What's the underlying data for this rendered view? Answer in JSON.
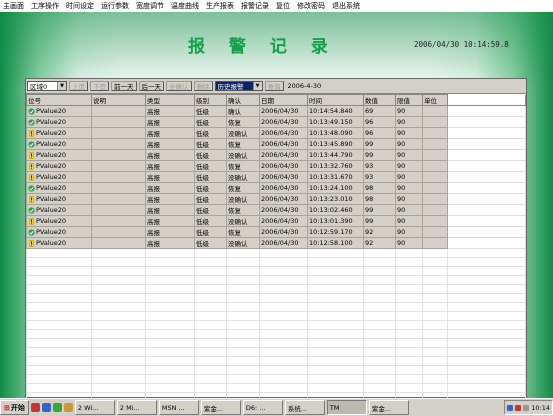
{
  "menu": [
    "主画面",
    "工序操作",
    "时间设定",
    "运行参数",
    "宽度调节",
    "温度曲线",
    "生产报表",
    "报警记录",
    "复位",
    "修改密码",
    "退出系统"
  ],
  "title": "报 警 记 录",
  "clock": "2006/04/30  10:14:59.8",
  "toolbar": {
    "area_select": "区域0",
    "btn_prev_page": "上页",
    "btn_next_page": "下页",
    "btn_prev_day": "前一天",
    "btn_next_day": "后一天",
    "btn_confirm_all": "全确认",
    "btn_delete": "删除",
    "history_select": "历史报警",
    "btn_query": "查询",
    "date": "2006-4-30"
  },
  "table": {
    "headers": [
      "位号",
      "说明",
      "类型",
      "级别",
      "确认",
      "日期",
      "时间",
      "数值",
      "限值",
      "单位"
    ],
    "rows": [
      {
        "icon": "check",
        "tag": "PValue20",
        "desc": "",
        "type": "高报",
        "level": "低级",
        "ack": "确认",
        "date": "2006/04/30",
        "time": "10:14:54.840",
        "value": "69",
        "limit": "90",
        "unit": ""
      },
      {
        "icon": "check",
        "tag": "PValue20",
        "desc": "",
        "type": "高报",
        "level": "低级",
        "ack": "恢复",
        "date": "2006/04/30",
        "time": "10:13:49.150",
        "value": "96",
        "limit": "90",
        "unit": ""
      },
      {
        "icon": "warn",
        "tag": "PValue20",
        "desc": "",
        "type": "高报",
        "level": "低级",
        "ack": "没确认",
        "date": "2006/04/30",
        "time": "10:13:48.090",
        "value": "96",
        "limit": "90",
        "unit": ""
      },
      {
        "icon": "check",
        "tag": "PValue20",
        "desc": "",
        "type": "高报",
        "level": "低级",
        "ack": "恢复",
        "date": "2006/04/30",
        "time": "10:13:45.890",
        "value": "99",
        "limit": "90",
        "unit": ""
      },
      {
        "icon": "warn",
        "tag": "PValue20",
        "desc": "",
        "type": "高报",
        "level": "低级",
        "ack": "没确认",
        "date": "2006/04/30",
        "time": "10:13:44.790",
        "value": "99",
        "limit": "90",
        "unit": ""
      },
      {
        "icon": "warn",
        "tag": "PValue20",
        "desc": "",
        "type": "高报",
        "level": "低级",
        "ack": "恢复",
        "date": "2006/04/30",
        "time": "10:13:32.760",
        "value": "93",
        "limit": "90",
        "unit": ""
      },
      {
        "icon": "warn",
        "tag": "PValue20",
        "desc": "",
        "type": "高报",
        "level": "低级",
        "ack": "没确认",
        "date": "2006/04/30",
        "time": "10:13:31.670",
        "value": "93",
        "limit": "90",
        "unit": ""
      },
      {
        "icon": "check",
        "tag": "PValue20",
        "desc": "",
        "type": "高报",
        "level": "低级",
        "ack": "恢复",
        "date": "2006/04/30",
        "time": "10:13:24.100",
        "value": "98",
        "limit": "90",
        "unit": ""
      },
      {
        "icon": "warn",
        "tag": "PValue20",
        "desc": "",
        "type": "高报",
        "level": "低级",
        "ack": "没确认",
        "date": "2006/04/30",
        "time": "10:13:23.010",
        "value": "98",
        "limit": "90",
        "unit": ""
      },
      {
        "icon": "check",
        "tag": "PValue20",
        "desc": "",
        "type": "高报",
        "level": "低级",
        "ack": "恢复",
        "date": "2006/04/30",
        "time": "10:13:02.460",
        "value": "99",
        "limit": "90",
        "unit": ""
      },
      {
        "icon": "warn",
        "tag": "PValue20",
        "desc": "",
        "type": "高报",
        "level": "低级",
        "ack": "没确认",
        "date": "2006/04/30",
        "time": "10:13:01.390",
        "value": "99",
        "limit": "90",
        "unit": ""
      },
      {
        "icon": "check",
        "tag": "PValue20",
        "desc": "",
        "type": "高报",
        "level": "低级",
        "ack": "恢复",
        "date": "2006/04/30",
        "time": "10:12:59.170",
        "value": "92",
        "limit": "90",
        "unit": ""
      },
      {
        "icon": "warn",
        "tag": "PValue20",
        "desc": "",
        "type": "高报",
        "level": "低级",
        "ack": "没确认",
        "date": "2006/04/30",
        "time": "10:12:58.100",
        "value": "92",
        "limit": "90",
        "unit": ""
      }
    ]
  },
  "taskbar": {
    "start": "开始",
    "tasks": [
      "2 Wi...",
      "2 Mi...",
      "MSN ...",
      "紫金...",
      "D6: ...",
      "系统...",
      "TM",
      "紫金..."
    ],
    "clock": "10:14"
  },
  "colors": {
    "title": "#14a046",
    "accent_green": "#0e8c44",
    "row_fill": "#d4d0c8"
  }
}
